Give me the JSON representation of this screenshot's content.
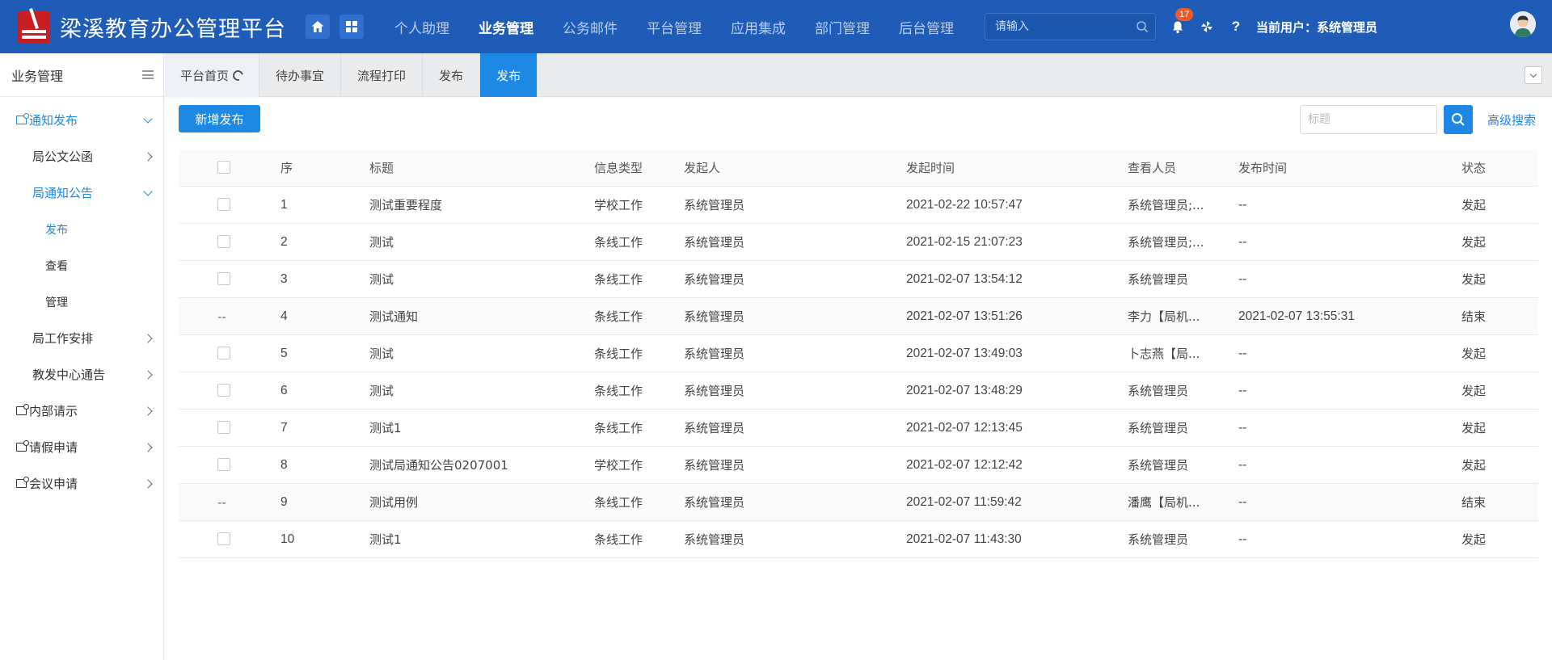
{
  "app": {
    "title": "梁溪教育办公管理平台"
  },
  "topnav": {
    "items": [
      {
        "label": "个人助理"
      },
      {
        "label": "业务管理",
        "active": true
      },
      {
        "label": "公务邮件"
      },
      {
        "label": "平台管理"
      },
      {
        "label": "应用集成"
      },
      {
        "label": "部门管理"
      },
      {
        "label": "后台管理"
      }
    ],
    "search_placeholder": "请输入",
    "notification_count": "17",
    "help": "?",
    "current_user": "当前用户：系统管理员"
  },
  "icons": {
    "home": "home-icon",
    "apps": "grid-icon",
    "search": "search-icon",
    "bell": "bell-icon",
    "pinwheel": "pinwheel-icon",
    "avatar": "user-avatar"
  },
  "colors": {
    "topbar": "#1e5cb8",
    "accent": "#1e88e5",
    "logo": "#c81e22",
    "badge": "#f15a22"
  },
  "sidebar": {
    "title": "业务管理",
    "items": [
      {
        "label": "通知发布"
      },
      {
        "label": "局公文公函"
      },
      {
        "label": "局通知公告"
      },
      {
        "label": "发布"
      },
      {
        "label": "查看"
      },
      {
        "label": "管理"
      },
      {
        "label": "局工作安排"
      },
      {
        "label": "教发中心通告"
      },
      {
        "label": "内部请示"
      },
      {
        "label": "请假申请"
      },
      {
        "label": "会议申请"
      }
    ]
  },
  "tabs": [
    {
      "label": "平台首页"
    },
    {
      "label": "待办事宜"
    },
    {
      "label": "流程打印"
    },
    {
      "label": "发布"
    },
    {
      "label": "发布",
      "active": true
    }
  ],
  "toolbar": {
    "add_label": "新增发布",
    "title_placeholder": "标题",
    "advanced_search": "高级搜索"
  },
  "table": {
    "columns": [
      "序",
      "标题",
      "信息类型",
      "发起人",
      "发起时间",
      "查看人员",
      "发布时间",
      "状态"
    ],
    "rows": [
      {
        "idx": "1",
        "title": "测试重要程度",
        "type": "学校工作",
        "author": "系统管理员",
        "start": "2021-02-22 10:57:47",
        "viewers": "系统管理员;...",
        "published": "--",
        "status": "发起",
        "selectable": true
      },
      {
        "idx": "2",
        "title": "测试",
        "type": "条线工作",
        "author": "系统管理员",
        "start": "2021-02-15 21:07:23",
        "viewers": "系统管理员;...",
        "published": "--",
        "status": "发起",
        "selectable": true
      },
      {
        "idx": "3",
        "title": "测试",
        "type": "条线工作",
        "author": "系统管理员",
        "start": "2021-02-07 13:54:12",
        "viewers": "系统管理员",
        "published": "--",
        "status": "发起",
        "selectable": true
      },
      {
        "idx": "4",
        "title": "测试通知",
        "type": "条线工作",
        "author": "系统管理员",
        "start": "2021-02-07 13:51:26",
        "viewers": "李力【局机...",
        "published": "2021-02-07 13:55:31",
        "status": "结束",
        "selectable": false
      },
      {
        "idx": "5",
        "title": "测试",
        "type": "条线工作",
        "author": "系统管理员",
        "start": "2021-02-07 13:49:03",
        "viewers": "卜志燕【局...",
        "published": "--",
        "status": "发起",
        "selectable": true
      },
      {
        "idx": "6",
        "title": "测试",
        "type": "条线工作",
        "author": "系统管理员",
        "start": "2021-02-07 13:48:29",
        "viewers": "系统管理员",
        "published": "--",
        "status": "发起",
        "selectable": true
      },
      {
        "idx": "7",
        "title": "测试1",
        "type": "条线工作",
        "author": "系统管理员",
        "start": "2021-02-07 12:13:45",
        "viewers": "系统管理员",
        "published": "--",
        "status": "发起",
        "selectable": true
      },
      {
        "idx": "8",
        "title": "测试局通知公告0207001",
        "type": "学校工作",
        "author": "系统管理员",
        "start": "2021-02-07 12:12:42",
        "viewers": "系统管理员",
        "published": "--",
        "status": "发起",
        "selectable": true
      },
      {
        "idx": "9",
        "title": "测试用例",
        "type": "条线工作",
        "author": "系统管理员",
        "start": "2021-02-07 11:59:42",
        "viewers": "潘鹰【局机...",
        "published": "--",
        "status": "结束",
        "selectable": false
      },
      {
        "idx": "10",
        "title": "测试1",
        "type": "条线工作",
        "author": "系统管理员",
        "start": "2021-02-07 11:43:30",
        "viewers": "系统管理员",
        "published": "--",
        "status": "发起",
        "selectable": true
      }
    ],
    "no_select_mark": "--"
  }
}
